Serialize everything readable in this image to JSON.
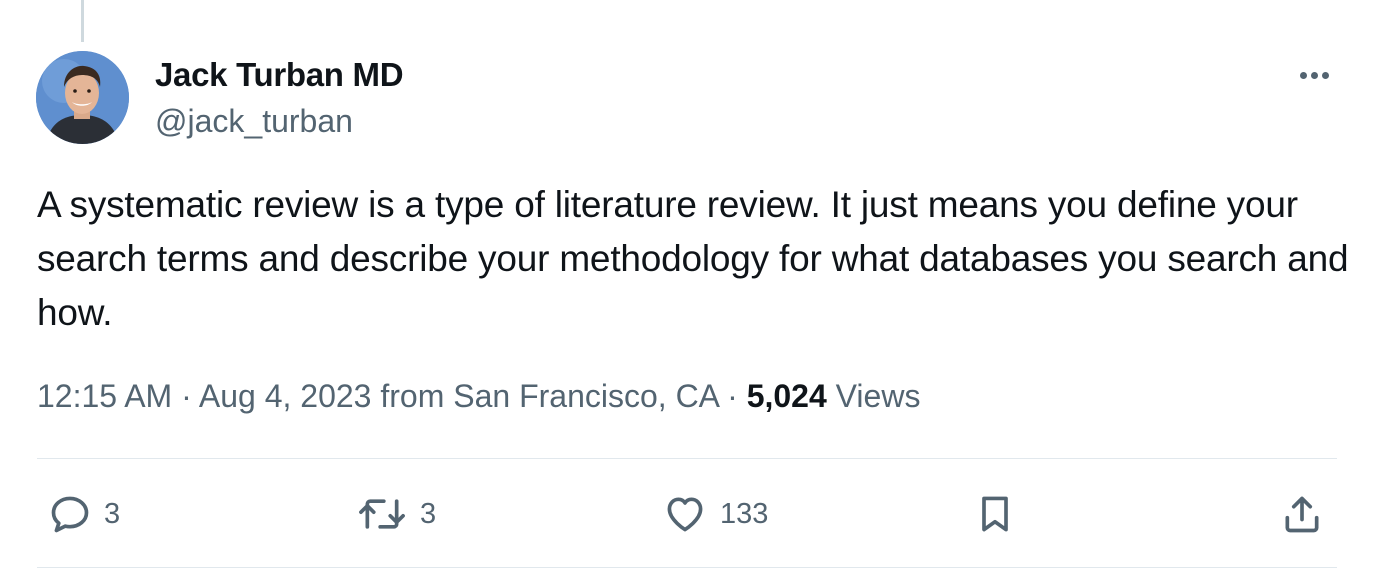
{
  "author": {
    "display_name": "Jack Turban MD",
    "handle": "@jack_turban"
  },
  "tweet": {
    "text": "A systematic review is a type of literature review. It just means you define your search terms and describe your methodology for what databases you search and how.",
    "timestamp": "12:15 AM · Aug 4, 2023 from San Francisco, CA · ",
    "views_count": "5,024",
    "views_label": " Views"
  },
  "actions": {
    "reply": {
      "icon": "reply-icon",
      "count": "3"
    },
    "retweet": {
      "icon": "retweet-icon",
      "count": "3"
    },
    "like": {
      "icon": "heart-icon",
      "count": "133"
    },
    "bookmark": {
      "icon": "bookmark-icon"
    },
    "share": {
      "icon": "share-icon"
    }
  },
  "colors": {
    "text_primary": "#0f1419",
    "text_secondary": "#536471",
    "divider": "#e1e8ed"
  }
}
